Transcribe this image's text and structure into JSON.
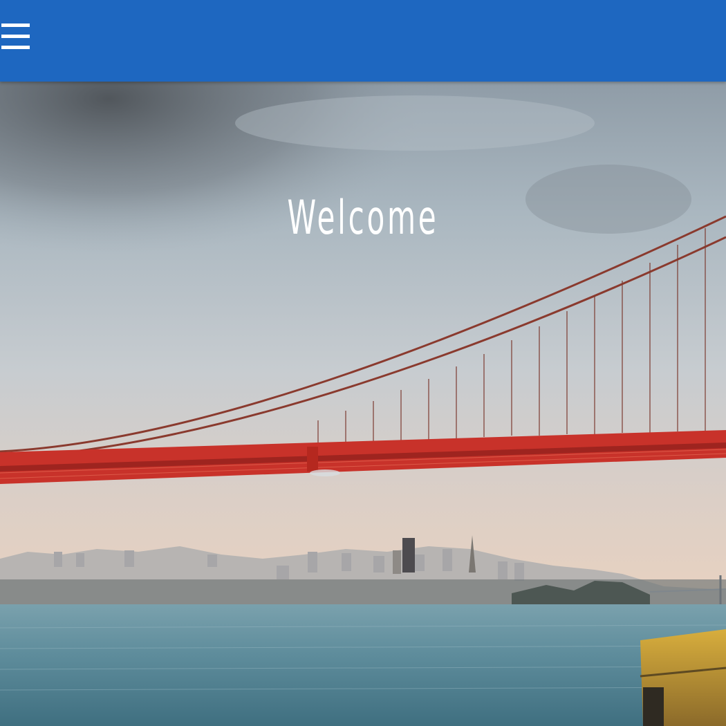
{
  "header": {
    "menu_icon": "hamburger-menu-icon",
    "background_color": "#1e67c0"
  },
  "hero": {
    "title": "Welcome",
    "image": "golden-gate-bridge-skyline-photo"
  },
  "colors": {
    "bridge": "#c8322a",
    "water": "#5f8d9c",
    "sky_top": "#8e9ba6",
    "sky_horizon": "#e6cfbe"
  }
}
